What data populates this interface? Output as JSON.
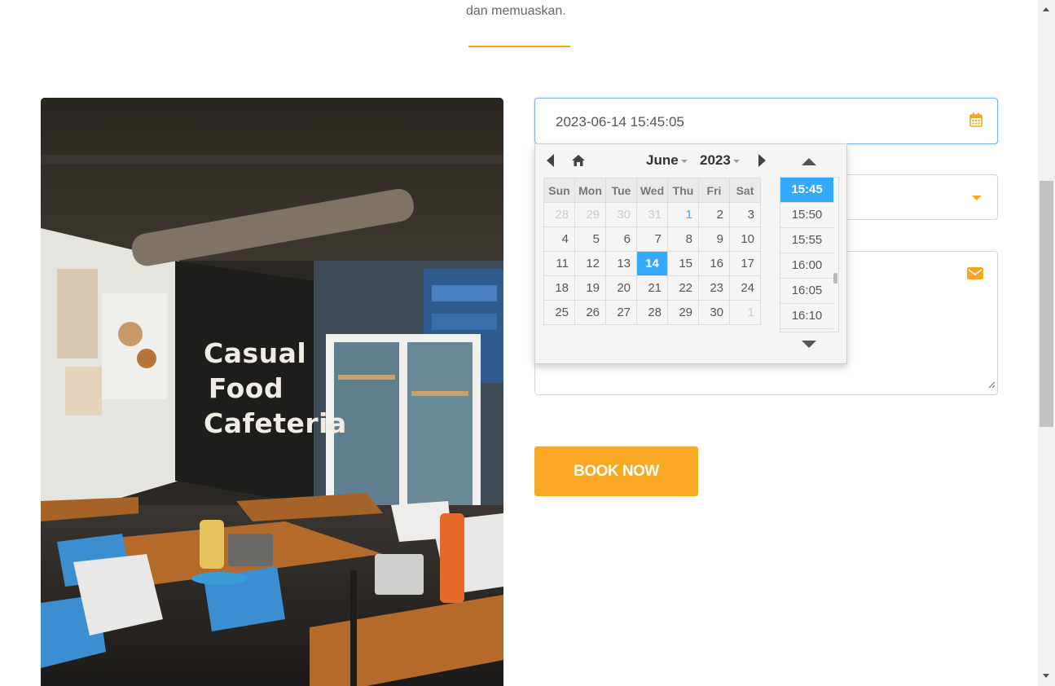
{
  "intro": {
    "text": "dan memuaskan."
  },
  "photo": {
    "sign_lines": [
      "Casual",
      "Food",
      "Cafeteria"
    ]
  },
  "form": {
    "datetime_value": "2023-06-14 15:45:05",
    "select_value": "",
    "message_value": "",
    "book_button_label": "BOOK NOW"
  },
  "picker": {
    "month": "June",
    "year": "2023",
    "weekdays": [
      "Sun",
      "Mon",
      "Tue",
      "Wed",
      "Thu",
      "Fri",
      "Sat"
    ],
    "weeks": [
      [
        "28",
        "29",
        "30",
        "31",
        "1",
        "2",
        "3"
      ],
      [
        "4",
        "5",
        "6",
        "7",
        "8",
        "9",
        "10"
      ],
      [
        "11",
        "12",
        "13",
        "14",
        "15",
        "16",
        "17"
      ],
      [
        "18",
        "19",
        "20",
        "21",
        "22",
        "23",
        "24"
      ],
      [
        "25",
        "26",
        "27",
        "28",
        "29",
        "30",
        "1"
      ]
    ],
    "times": [
      "15:45",
      "15:50",
      "15:55",
      "16:00",
      "16:05",
      "16:10"
    ],
    "selected_time": "15:45"
  },
  "colors": {
    "accent": "#f9a825",
    "selected": "#33aaff"
  },
  "icons": {
    "datetime": "calendar-icon",
    "select": "caret-down-icon",
    "message": "envelope-icon",
    "prev": "prev-month-icon",
    "next": "next-month-icon",
    "home": "home-icon"
  }
}
